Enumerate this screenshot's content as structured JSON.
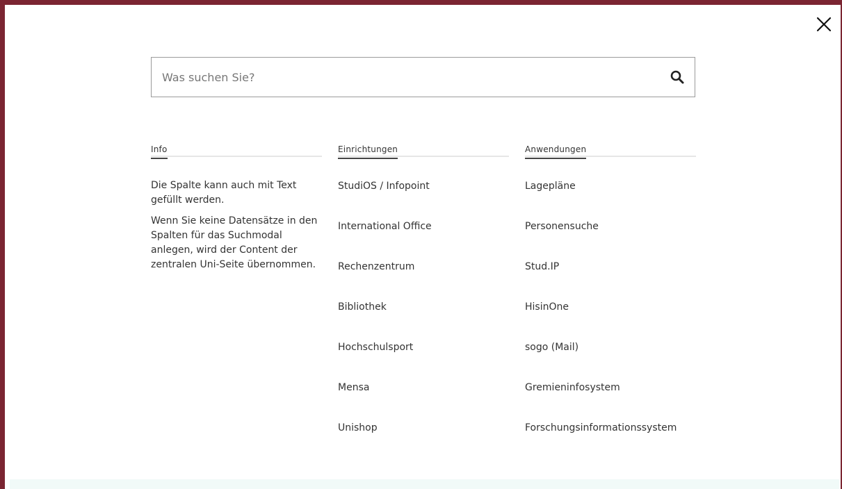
{
  "search": {
    "placeholder": "Was suchen Sie?",
    "value": ""
  },
  "columns": {
    "info": {
      "title": "Info",
      "paragraphs": [
        "Die Spalte kann auch mit Text gefüllt werden.",
        "Wenn Sie keine Datensätze in den Spalten für das Suchmodal anlegen, wird der Content der zentralen Uni-Seite übernommen."
      ]
    },
    "einrichtungen": {
      "title": "Einrichtungen",
      "items": [
        "StudiOS / Infopoint",
        "International Office",
        "Rechenzentrum",
        "Bibliothek",
        "Hochschulsport",
        "Mensa",
        "Unishop"
      ]
    },
    "anwendungen": {
      "title": "Anwendungen",
      "items": [
        "Lagepläne",
        "Personensuche",
        "Stud.IP",
        "HisinOne",
        "sogo (Mail)",
        "Gremieninfosystem",
        "Forschungsinformationssystem"
      ]
    }
  },
  "icons": {
    "close": "close-icon",
    "search": "search-icon"
  },
  "colors": {
    "frame": "#7b2532",
    "text": "#333333",
    "bottom_strip": "#f1faf8"
  }
}
